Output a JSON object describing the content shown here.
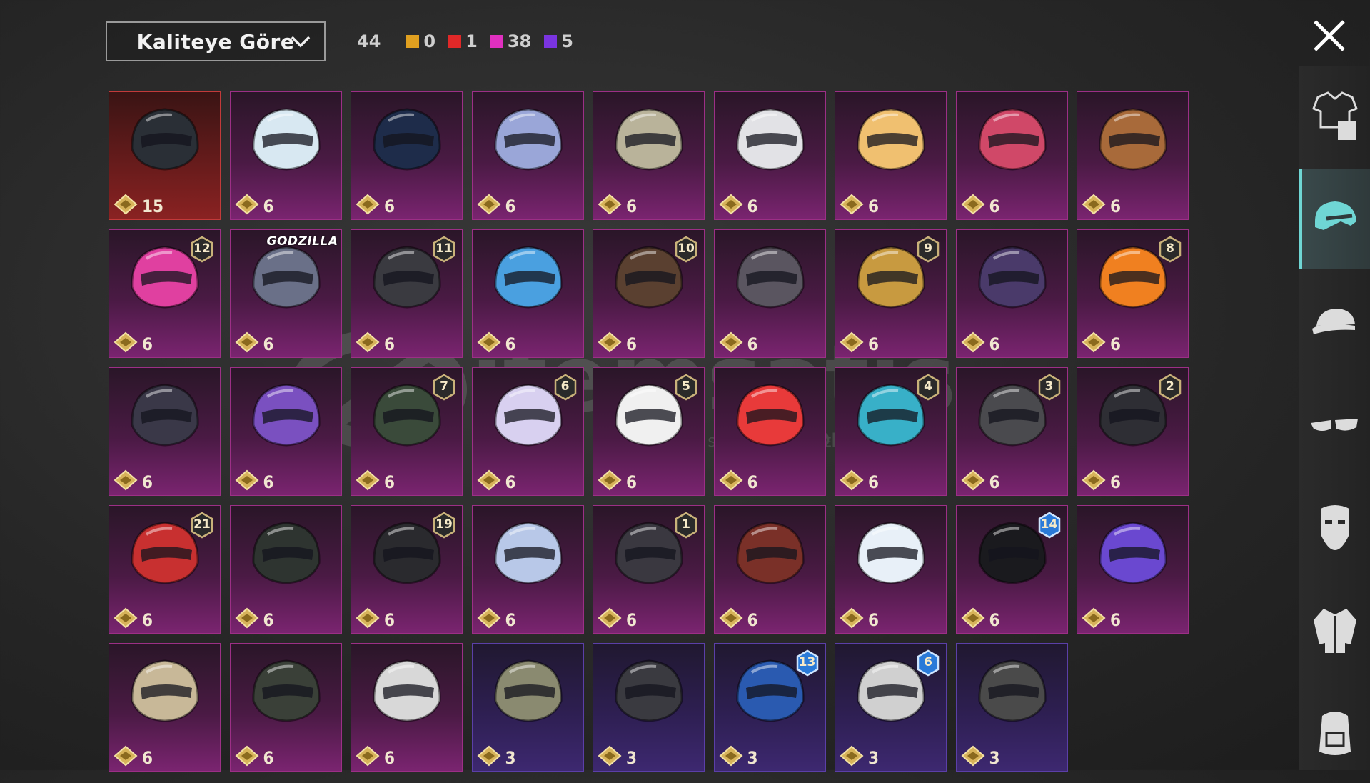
{
  "sort": {
    "label": "Kaliteye Göre"
  },
  "counts": {
    "total": "44",
    "legend": [
      {
        "color": "#e0a020",
        "value": "0"
      },
      {
        "color": "#e02828",
        "value": "1"
      },
      {
        "color": "#e030c0",
        "value": "38"
      },
      {
        "color": "#7a34e0",
        "value": "5"
      }
    ]
  },
  "watermark": {
    "brand": "itemsatis",
    "tagline": "HESAP / SKIN / ITEM / E-PIN",
    "domain": ".com"
  },
  "items": [
    {
      "price": "15",
      "rarity": "red",
      "color": "#2a2f36",
      "badge": ""
    },
    {
      "price": "6",
      "rarity": "pink",
      "color": "#d8e8f2",
      "badge": ""
    },
    {
      "price": "6",
      "rarity": "pink",
      "color": "#1e2c4a",
      "badge": ""
    },
    {
      "price": "6",
      "rarity": "pink",
      "color": "#9aa6d8",
      "badge": ""
    },
    {
      "price": "6",
      "rarity": "pink",
      "color": "#b9b39a",
      "badge": ""
    },
    {
      "price": "6",
      "rarity": "pink",
      "color": "#e2e2e6",
      "badge": ""
    },
    {
      "price": "6",
      "rarity": "pink",
      "color": "#f0c070",
      "badge": ""
    },
    {
      "price": "6",
      "rarity": "pink",
      "color": "#d04868",
      "badge": ""
    },
    {
      "price": "6",
      "rarity": "pink",
      "color": "#a86a3a",
      "badge": ""
    },
    {
      "price": "6",
      "rarity": "pink",
      "color": "#e040a0",
      "badge": "12"
    },
    {
      "price": "6",
      "rarity": "pink",
      "color": "#6a7088",
      "badge": "GODZILLA"
    },
    {
      "price": "6",
      "rarity": "pink",
      "color": "#3a3a40",
      "badge": "11"
    },
    {
      "price": "6",
      "rarity": "pink",
      "color": "#4aa0e0",
      "badge": ""
    },
    {
      "price": "6",
      "rarity": "pink",
      "color": "#5a4030",
      "badge": "10"
    },
    {
      "price": "6",
      "rarity": "pink",
      "color": "#5a5560",
      "badge": ""
    },
    {
      "price": "6",
      "rarity": "pink",
      "color": "#c89a40",
      "badge": "9"
    },
    {
      "price": "6",
      "rarity": "pink",
      "color": "#4a3a6a",
      "badge": ""
    },
    {
      "price": "6",
      "rarity": "pink",
      "color": "#f08020",
      "badge": "8"
    },
    {
      "price": "6",
      "rarity": "pink",
      "color": "#3a3848",
      "badge": ""
    },
    {
      "price": "6",
      "rarity": "pink",
      "color": "#7a50c0",
      "badge": ""
    },
    {
      "price": "6",
      "rarity": "pink",
      "color": "#3a4a3a",
      "badge": "7"
    },
    {
      "price": "6",
      "rarity": "pink",
      "color": "#d8d0f0",
      "badge": "6"
    },
    {
      "price": "6",
      "rarity": "pink",
      "color": "#f0f0f0",
      "badge": "5"
    },
    {
      "price": "6",
      "rarity": "pink",
      "color": "#e83a3a",
      "badge": ""
    },
    {
      "price": "6",
      "rarity": "pink",
      "color": "#38b0c8",
      "badge": "4"
    },
    {
      "price": "6",
      "rarity": "pink",
      "color": "#4a4a4e",
      "badge": "3"
    },
    {
      "price": "6",
      "rarity": "pink",
      "color": "#2e2e34",
      "badge": "2"
    },
    {
      "price": "6",
      "rarity": "pink",
      "color": "#c83030",
      "badge": "21"
    },
    {
      "price": "6",
      "rarity": "pink",
      "color": "#2e3430",
      "badge": ""
    },
    {
      "price": "6",
      "rarity": "pink",
      "color": "#2a2a2e",
      "badge": "19"
    },
    {
      "price": "6",
      "rarity": "pink",
      "color": "#b8c8e8",
      "badge": ""
    },
    {
      "price": "6",
      "rarity": "pink",
      "color": "#3a3840",
      "badge": "1"
    },
    {
      "price": "6",
      "rarity": "pink",
      "color": "#7a3028",
      "badge": ""
    },
    {
      "price": "6",
      "rarity": "pink",
      "color": "#e8f0f8",
      "badge": ""
    },
    {
      "price": "6",
      "rarity": "pink",
      "color": "#1a1a1e",
      "badge": "14"
    },
    {
      "price": "6",
      "rarity": "pink",
      "color": "#6a48d0",
      "badge": ""
    },
    {
      "price": "6",
      "rarity": "pink",
      "color": "#c8b898",
      "badge": ""
    },
    {
      "price": "6",
      "rarity": "pink",
      "color": "#3a4038",
      "badge": ""
    },
    {
      "price": "6",
      "rarity": "pink",
      "color": "#d8d8d8",
      "badge": ""
    },
    {
      "price": "3",
      "rarity": "purple",
      "color": "#8a8a70",
      "badge": ""
    },
    {
      "price": "3",
      "rarity": "purple",
      "color": "#3a3a40",
      "badge": ""
    },
    {
      "price": "3",
      "rarity": "purple",
      "color": "#2a5ab0",
      "badge": "13"
    },
    {
      "price": "3",
      "rarity": "purple",
      "color": "#d0d0d0",
      "badge": "6"
    },
    {
      "price": "3",
      "rarity": "purple",
      "color": "#4a4a4a",
      "badge": ""
    }
  ],
  "sidebar": [
    {
      "icon": "outfit-icon",
      "active": false
    },
    {
      "icon": "helmet-icon",
      "active": true
    },
    {
      "icon": "cap-icon",
      "active": false
    },
    {
      "icon": "glasses-icon",
      "active": false
    },
    {
      "icon": "mask-icon",
      "active": false
    },
    {
      "icon": "jacket-icon",
      "active": false
    },
    {
      "icon": "backpack-icon",
      "active": false
    }
  ]
}
